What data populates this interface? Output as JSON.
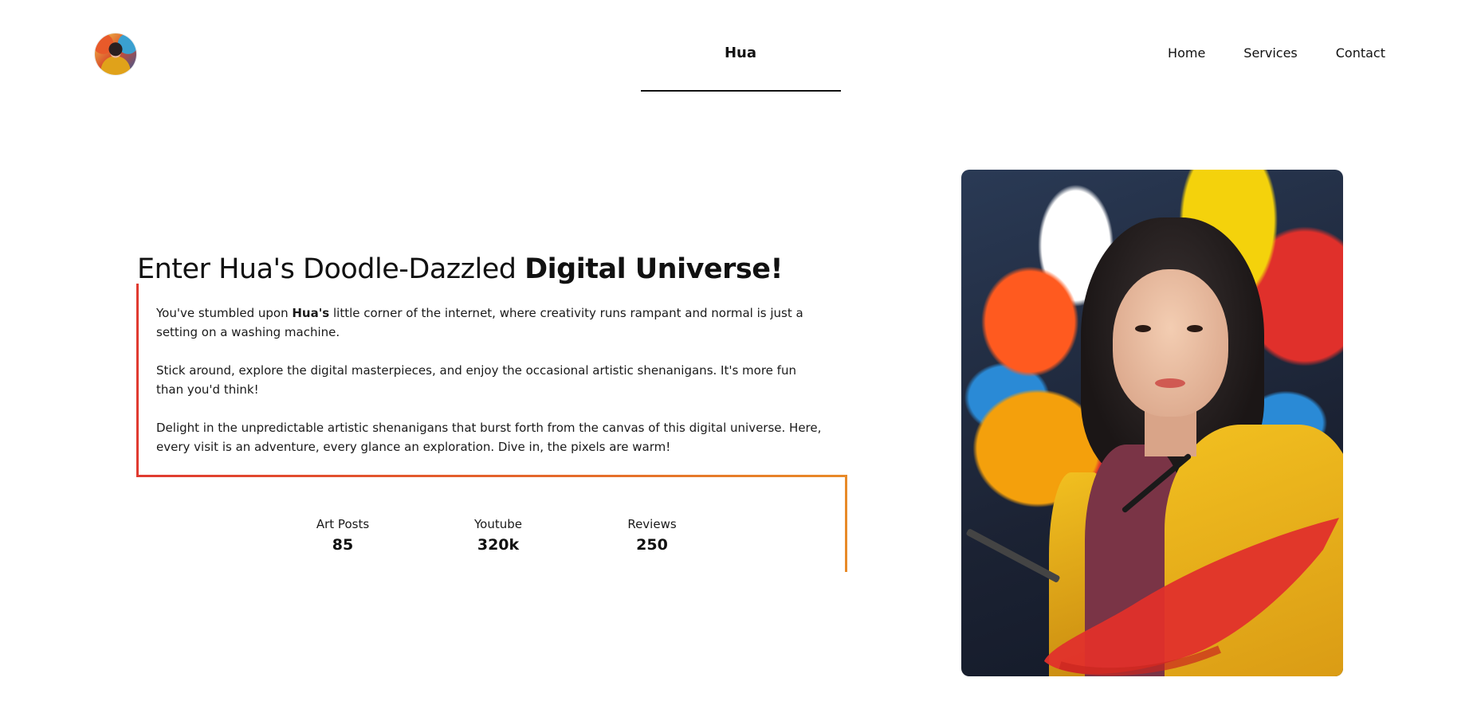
{
  "header": {
    "avatar_icon": "avatar-image",
    "brand": "Hua",
    "nav": [
      "Home",
      "Services",
      "Contact"
    ]
  },
  "hero": {
    "title_light": "Enter Hua's Doodle-Dazzled ",
    "title_bold": "Digital Universe!",
    "paragraphs": {
      "p1_before": "You've stumbled upon ",
      "p1_bold": "Hua's",
      "p1_after": " little corner of the internet, where creativity runs rampant and normal is just a setting on a washing machine.",
      "p2": "Stick around, explore the digital masterpieces, and enjoy the occasional artistic shenanigans. It's more fun than you'd think!",
      "p3": "Delight in the unpredictable artistic shenanigans that burst forth from the canvas of this digital universe. Here, every visit is an adventure, every glance an exploration. Dive in, the pixels are warm!"
    },
    "accent_colors": [
      "#e03a30",
      "#e88a28"
    ]
  },
  "stats": [
    {
      "label": "Art Posts",
      "value": "85"
    },
    {
      "label": "Youtube",
      "value": "320k"
    },
    {
      "label": "Reviews",
      "value": "250"
    }
  ],
  "portrait": {
    "icon": "artist-portrait-image",
    "swoosh_color": "#e0302b"
  }
}
